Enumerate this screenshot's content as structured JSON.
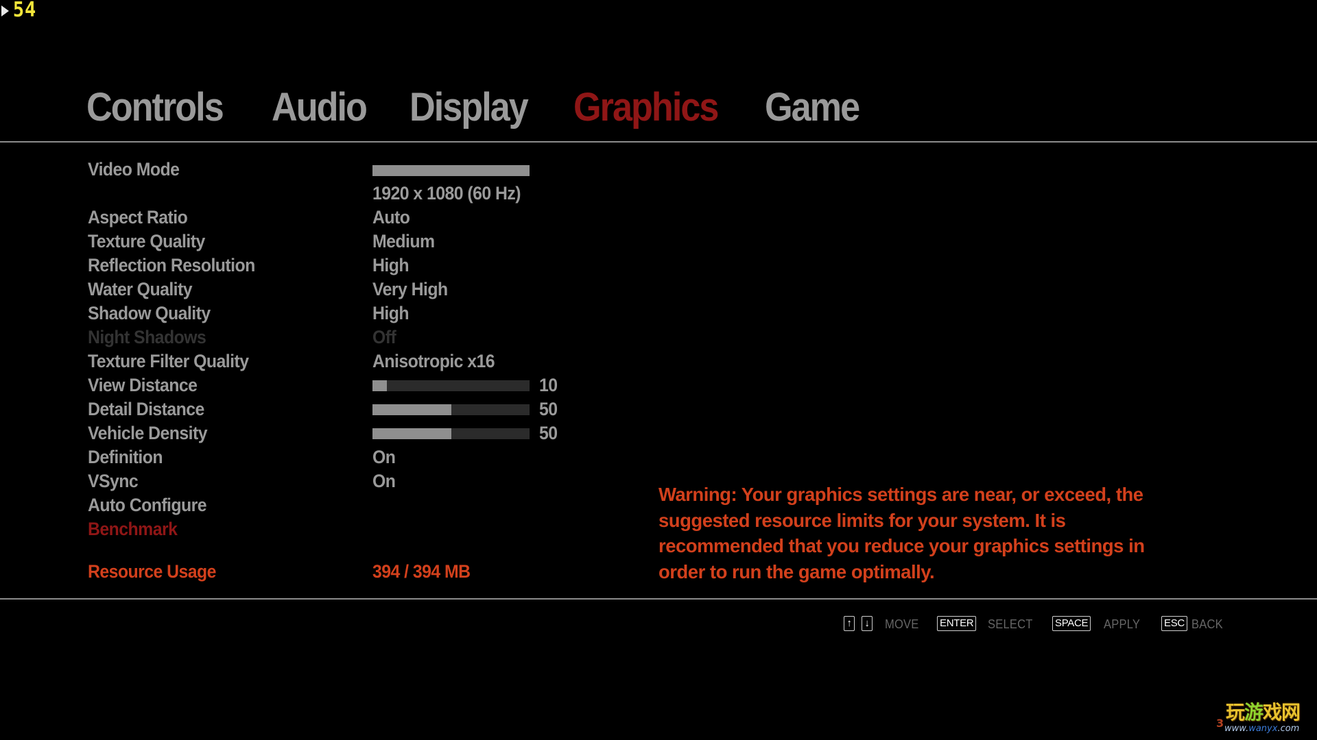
{
  "overlay": {
    "fps": "54",
    "cursor_icon": "cursor-arrow-icon"
  },
  "tabs": [
    {
      "label": "Controls",
      "active": false
    },
    {
      "label": "Audio",
      "active": false
    },
    {
      "label": "Display",
      "active": false
    },
    {
      "label": "Graphics",
      "active": true
    },
    {
      "label": "Game",
      "active": false
    }
  ],
  "settings": {
    "video_mode": {
      "label": "Video Mode",
      "value": "1920 x 1080 (60 Hz)"
    },
    "rows": [
      {
        "label": "Aspect Ratio",
        "value": "Auto"
      },
      {
        "label": "Texture Quality",
        "value": "Medium"
      },
      {
        "label": "Reflection Resolution",
        "value": "High"
      },
      {
        "label": "Water Quality",
        "value": "Very High"
      },
      {
        "label": "Shadow Quality",
        "value": "High"
      },
      {
        "label": "Night Shadows",
        "value": "Off",
        "disabled": true
      },
      {
        "label": "Texture Filter Quality",
        "value": "Anisotropic x16"
      }
    ],
    "sliders": [
      {
        "label": "View Distance",
        "value": "10",
        "fill_percent": 9
      },
      {
        "label": "Detail Distance",
        "value": "50",
        "fill_percent": 50
      },
      {
        "label": "Vehicle Density",
        "value": "50",
        "fill_percent": 50
      }
    ],
    "toggles": [
      {
        "label": "Definition",
        "value": "On"
      },
      {
        "label": "VSync",
        "value": "On"
      }
    ],
    "actions": [
      {
        "label": "Auto Configure"
      },
      {
        "label": "Benchmark",
        "selected": true
      }
    ],
    "resource": {
      "label": "Resource Usage",
      "value": "394 / 394 MB"
    }
  },
  "warning": {
    "text": "Warning: Your graphics settings are near, or exceed, the suggested resource limits for your system. It is recommended that you reduce your graphics settings in order to run the game optimally."
  },
  "hints": {
    "up_key": "↑",
    "down_key": "↓",
    "move_label": "MOVE",
    "enter_key": "ENTER",
    "select_label": "SELECT",
    "space_key": "SPACE",
    "apply_label": "APPLY",
    "esc_key": "ESC",
    "back_label": "BACK"
  },
  "watermark": {
    "title_a": "玩",
    "title_b": "游",
    "title_c": "戏网",
    "url_prefix": "www.",
    "url_brand": "wanyx",
    "url_suffix": ".com",
    "num": "3"
  },
  "colors": {
    "active_tab": "#8f1616",
    "inactive_text": "#9a9a9a",
    "disabled_text": "#333333",
    "warning": "#d2401c",
    "fps": "#f2e53a",
    "slider_fill": "#8f8f8f",
    "slider_track": "#2b2b2b"
  }
}
